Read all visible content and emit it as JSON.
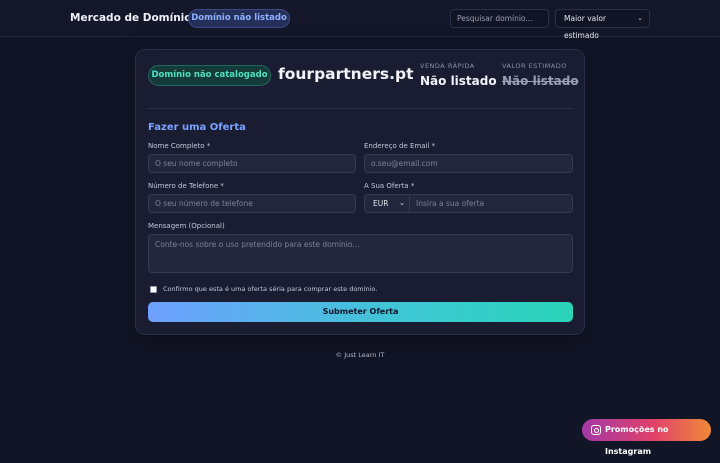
{
  "header": {
    "brand": "Mercado de Domínios",
    "badge": "Domínio não listado",
    "search_placeholder": "Pesquisar domínio...",
    "sort_selected": "Maior valor estimado"
  },
  "domain": {
    "category_badge": "Domínio não catalogado",
    "name": "fourpartners.pt",
    "quick_sale_label": "VENDA RÁPIDA",
    "quick_sale_value": "Não listado",
    "estimated_label": "VALOR ESTIMADO",
    "estimated_value": "Não listado"
  },
  "form": {
    "title": "Fazer uma Oferta",
    "name_label": "Nome Completo *",
    "name_placeholder": "O seu nome completo",
    "email_label": "Endereço de Email *",
    "email_placeholder": "o.seu@email.com",
    "phone_label": "Número de Telefone *",
    "phone_placeholder": "O seu número de telefone",
    "offer_label": "A Sua Oferta *",
    "currency": "EUR",
    "offer_placeholder": "Insira a sua oferta",
    "message_label": "Mensagem (Opcional)",
    "message_placeholder": "Conte-nos sobre o uso pretendido para este domínio...",
    "confirm_label": "Confirmo que esta é uma oferta séria para comprar este domínio.",
    "submit_label": "Submeter Oferta"
  },
  "footer": {
    "copyright": "© Just Learn IT"
  },
  "promo": {
    "label": "Promoções no Instagram"
  }
}
